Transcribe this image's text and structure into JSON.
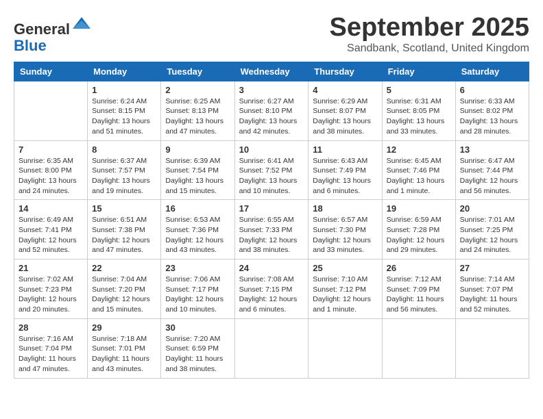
{
  "header": {
    "logo_line1": "General",
    "logo_line2": "Blue",
    "month": "September 2025",
    "location": "Sandbank, Scotland, United Kingdom"
  },
  "weekdays": [
    "Sunday",
    "Monday",
    "Tuesday",
    "Wednesday",
    "Thursday",
    "Friday",
    "Saturday"
  ],
  "weeks": [
    [
      {
        "day": "",
        "info": ""
      },
      {
        "day": "1",
        "info": "Sunrise: 6:24 AM\nSunset: 8:15 PM\nDaylight: 13 hours\nand 51 minutes."
      },
      {
        "day": "2",
        "info": "Sunrise: 6:25 AM\nSunset: 8:13 PM\nDaylight: 13 hours\nand 47 minutes."
      },
      {
        "day": "3",
        "info": "Sunrise: 6:27 AM\nSunset: 8:10 PM\nDaylight: 13 hours\nand 42 minutes."
      },
      {
        "day": "4",
        "info": "Sunrise: 6:29 AM\nSunset: 8:07 PM\nDaylight: 13 hours\nand 38 minutes."
      },
      {
        "day": "5",
        "info": "Sunrise: 6:31 AM\nSunset: 8:05 PM\nDaylight: 13 hours\nand 33 minutes."
      },
      {
        "day": "6",
        "info": "Sunrise: 6:33 AM\nSunset: 8:02 PM\nDaylight: 13 hours\nand 28 minutes."
      }
    ],
    [
      {
        "day": "7",
        "info": "Sunrise: 6:35 AM\nSunset: 8:00 PM\nDaylight: 13 hours\nand 24 minutes."
      },
      {
        "day": "8",
        "info": "Sunrise: 6:37 AM\nSunset: 7:57 PM\nDaylight: 13 hours\nand 19 minutes."
      },
      {
        "day": "9",
        "info": "Sunrise: 6:39 AM\nSunset: 7:54 PM\nDaylight: 13 hours\nand 15 minutes."
      },
      {
        "day": "10",
        "info": "Sunrise: 6:41 AM\nSunset: 7:52 PM\nDaylight: 13 hours\nand 10 minutes."
      },
      {
        "day": "11",
        "info": "Sunrise: 6:43 AM\nSunset: 7:49 PM\nDaylight: 13 hours\nand 6 minutes."
      },
      {
        "day": "12",
        "info": "Sunrise: 6:45 AM\nSunset: 7:46 PM\nDaylight: 13 hours\nand 1 minute."
      },
      {
        "day": "13",
        "info": "Sunrise: 6:47 AM\nSunset: 7:44 PM\nDaylight: 12 hours\nand 56 minutes."
      }
    ],
    [
      {
        "day": "14",
        "info": "Sunrise: 6:49 AM\nSunset: 7:41 PM\nDaylight: 12 hours\nand 52 minutes."
      },
      {
        "day": "15",
        "info": "Sunrise: 6:51 AM\nSunset: 7:38 PM\nDaylight: 12 hours\nand 47 minutes."
      },
      {
        "day": "16",
        "info": "Sunrise: 6:53 AM\nSunset: 7:36 PM\nDaylight: 12 hours\nand 43 minutes."
      },
      {
        "day": "17",
        "info": "Sunrise: 6:55 AM\nSunset: 7:33 PM\nDaylight: 12 hours\nand 38 minutes."
      },
      {
        "day": "18",
        "info": "Sunrise: 6:57 AM\nSunset: 7:30 PM\nDaylight: 12 hours\nand 33 minutes."
      },
      {
        "day": "19",
        "info": "Sunrise: 6:59 AM\nSunset: 7:28 PM\nDaylight: 12 hours\nand 29 minutes."
      },
      {
        "day": "20",
        "info": "Sunrise: 7:01 AM\nSunset: 7:25 PM\nDaylight: 12 hours\nand 24 minutes."
      }
    ],
    [
      {
        "day": "21",
        "info": "Sunrise: 7:02 AM\nSunset: 7:23 PM\nDaylight: 12 hours\nand 20 minutes."
      },
      {
        "day": "22",
        "info": "Sunrise: 7:04 AM\nSunset: 7:20 PM\nDaylight: 12 hours\nand 15 minutes."
      },
      {
        "day": "23",
        "info": "Sunrise: 7:06 AM\nSunset: 7:17 PM\nDaylight: 12 hours\nand 10 minutes."
      },
      {
        "day": "24",
        "info": "Sunrise: 7:08 AM\nSunset: 7:15 PM\nDaylight: 12 hours\nand 6 minutes."
      },
      {
        "day": "25",
        "info": "Sunrise: 7:10 AM\nSunset: 7:12 PM\nDaylight: 12 hours\nand 1 minute."
      },
      {
        "day": "26",
        "info": "Sunrise: 7:12 AM\nSunset: 7:09 PM\nDaylight: 11 hours\nand 56 minutes."
      },
      {
        "day": "27",
        "info": "Sunrise: 7:14 AM\nSunset: 7:07 PM\nDaylight: 11 hours\nand 52 minutes."
      }
    ],
    [
      {
        "day": "28",
        "info": "Sunrise: 7:16 AM\nSunset: 7:04 PM\nDaylight: 11 hours\nand 47 minutes."
      },
      {
        "day": "29",
        "info": "Sunrise: 7:18 AM\nSunset: 7:01 PM\nDaylight: 11 hours\nand 43 minutes."
      },
      {
        "day": "30",
        "info": "Sunrise: 7:20 AM\nSunset: 6:59 PM\nDaylight: 11 hours\nand 38 minutes."
      },
      {
        "day": "",
        "info": ""
      },
      {
        "day": "",
        "info": ""
      },
      {
        "day": "",
        "info": ""
      },
      {
        "day": "",
        "info": ""
      }
    ]
  ]
}
